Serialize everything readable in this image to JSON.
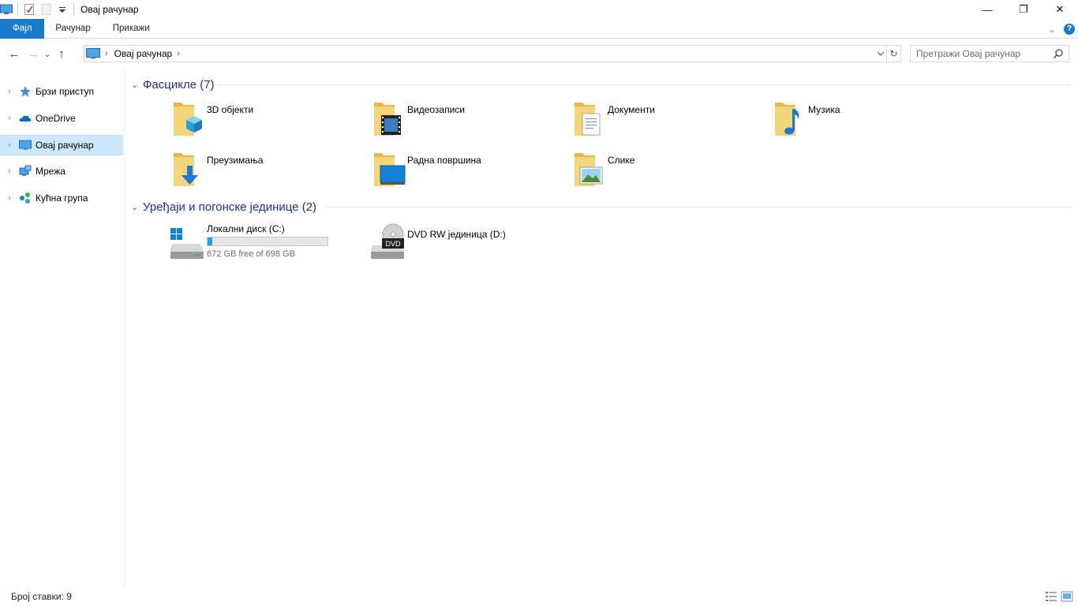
{
  "window": {
    "title": "Овај рачунар",
    "minimize_glyph": "—",
    "maximize_glyph": "❐",
    "close_glyph": "✕"
  },
  "quick_access_toolbar": {
    "icons": [
      "computer-icon",
      "properties-icon",
      "new-folder-icon",
      "customize-dropdown-icon"
    ]
  },
  "ribbon": {
    "tabs": [
      {
        "label": "Фајл",
        "active": true
      },
      {
        "label": "Рачунар",
        "active": false
      },
      {
        "label": "Прикажи",
        "active": false
      }
    ],
    "expand_glyph": "⌄",
    "help_glyph": "?"
  },
  "nav": {
    "back_glyph": "←",
    "forward_glyph": "→",
    "recent_glyph": "⌄",
    "up_glyph": "↑",
    "breadcrumb": [
      "Овај рачунар"
    ],
    "crumb_sep": "›",
    "refresh_glyph": "↻"
  },
  "search": {
    "placeholder": "Претражи Овај рачунар"
  },
  "sidebar": {
    "items": [
      {
        "label": "Брзи приступ",
        "icon": "star-icon",
        "selected": false
      },
      {
        "label": "OneDrive",
        "icon": "cloud-icon",
        "selected": false
      },
      {
        "label": "Овај рачунар",
        "icon": "computer-icon",
        "selected": true
      },
      {
        "label": "Мрежа",
        "icon": "network-icon",
        "selected": false
      },
      {
        "label": "Кућна група",
        "icon": "homegroup-icon",
        "selected": false
      }
    ],
    "chevron_glyph": "›"
  },
  "main": {
    "folders_group": {
      "title": "Фасцикле (7)",
      "items": [
        {
          "label": "3D објекти",
          "icon": "3d-objects-folder-icon"
        },
        {
          "label": "Видеозаписи",
          "icon": "videos-folder-icon"
        },
        {
          "label": "Документи",
          "icon": "documents-folder-icon"
        },
        {
          "label": "Музика",
          "icon": "music-folder-icon"
        },
        {
          "label": "Преузимања",
          "icon": "downloads-folder-icon"
        },
        {
          "label": "Радна површина",
          "icon": "desktop-folder-icon"
        },
        {
          "label": "Слике",
          "icon": "pictures-folder-icon"
        }
      ]
    },
    "drives_group": {
      "title": "Уређаји и погонске јединице (2)",
      "drives": [
        {
          "label": "Локални диск (C:)",
          "free_text": "672 GB free of 698 GB",
          "used_fraction": 0.037,
          "icon": "local-disk-icon"
        },
        {
          "label": "DVD RW јединица (D:)",
          "icon": "dvd-drive-icon",
          "icon_text": "DVD"
        }
      ]
    },
    "group_chevron_glyph": "⌄"
  },
  "status": {
    "item_count_text": "Број ставки: 9"
  },
  "colors": {
    "accent": "#1979ca",
    "group_title": "#1e3287",
    "selection": "#cce8ff",
    "folder": "#f5d57a",
    "drive_bar": "#26a0da"
  }
}
